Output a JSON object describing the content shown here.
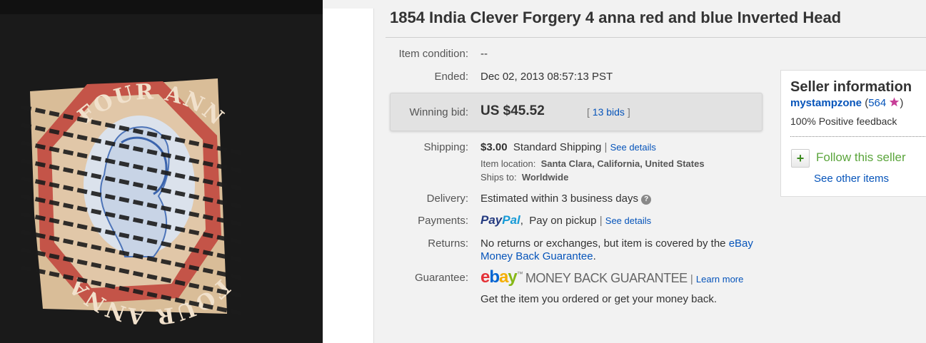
{
  "listing": {
    "title": "1854 India Clever Forgery 4 anna red and blue Inverted Head"
  },
  "details": {
    "condition_label": "Item condition:",
    "condition_value": "--",
    "ended_label": "Ended:",
    "ended_value": "Dec 02, 2013  08:57:13 PST",
    "winning_bid_label": "Winning bid:",
    "winning_bid_value": "US $45.52",
    "bids_open": "[",
    "bids_link": "13 bids",
    "bids_close": "]",
    "shipping_label": "Shipping:",
    "shipping_price": "$3.00",
    "shipping_method": "Standard Shipping",
    "shipping_sep": "|",
    "shipping_link": "See details",
    "location_label": "Item location:",
    "location_value": "Santa Clara, California, United States",
    "ships_to_label": "Ships to:",
    "ships_to_value": "Worldwide",
    "delivery_label": "Delivery:",
    "delivery_value": "Estimated within 3 business days",
    "delivery_info": "?",
    "payments_label": "Payments:",
    "paypal_part1": "Pay",
    "paypal_part2": "Pal",
    "payments_value": "Pay on pickup",
    "payments_sep": "|",
    "payments_link": "See details",
    "returns_label": "Returns:",
    "returns_text": "No returns or exchanges, but item is covered by the",
    "returns_link1": "eBay",
    "returns_link2": "Money Back Guarantee",
    "returns_period": ".",
    "guarantee_label": "Guarantee:",
    "ebay_e": "e",
    "ebay_b": "b",
    "ebay_a": "a",
    "ebay_y": "y",
    "ebay_tm": "™",
    "guarantee_logo_text": "MONEY BACK GUARANTEE",
    "guarantee_sep": "|",
    "guarantee_link": "Learn more",
    "guarantee_text": "Get the item you ordered or get your money back."
  },
  "seller": {
    "title": "Seller information",
    "name": "mystampzone",
    "score_open": "(",
    "score": "564",
    "score_close": ")",
    "star_color": "#c73e98",
    "feedback": "100% Positive feedback",
    "follow_icon": "+",
    "follow": "Follow this seller",
    "see_other": "See other items"
  },
  "stamp": {
    "top_text": "FOUR ANNAS",
    "bottom_text": "FOUR ANNAS"
  },
  "colors": {
    "link": "#0654ba",
    "follow_green": "#5ba53c",
    "paypal_dark": "#253b80",
    "paypal_light": "#179bd7"
  }
}
